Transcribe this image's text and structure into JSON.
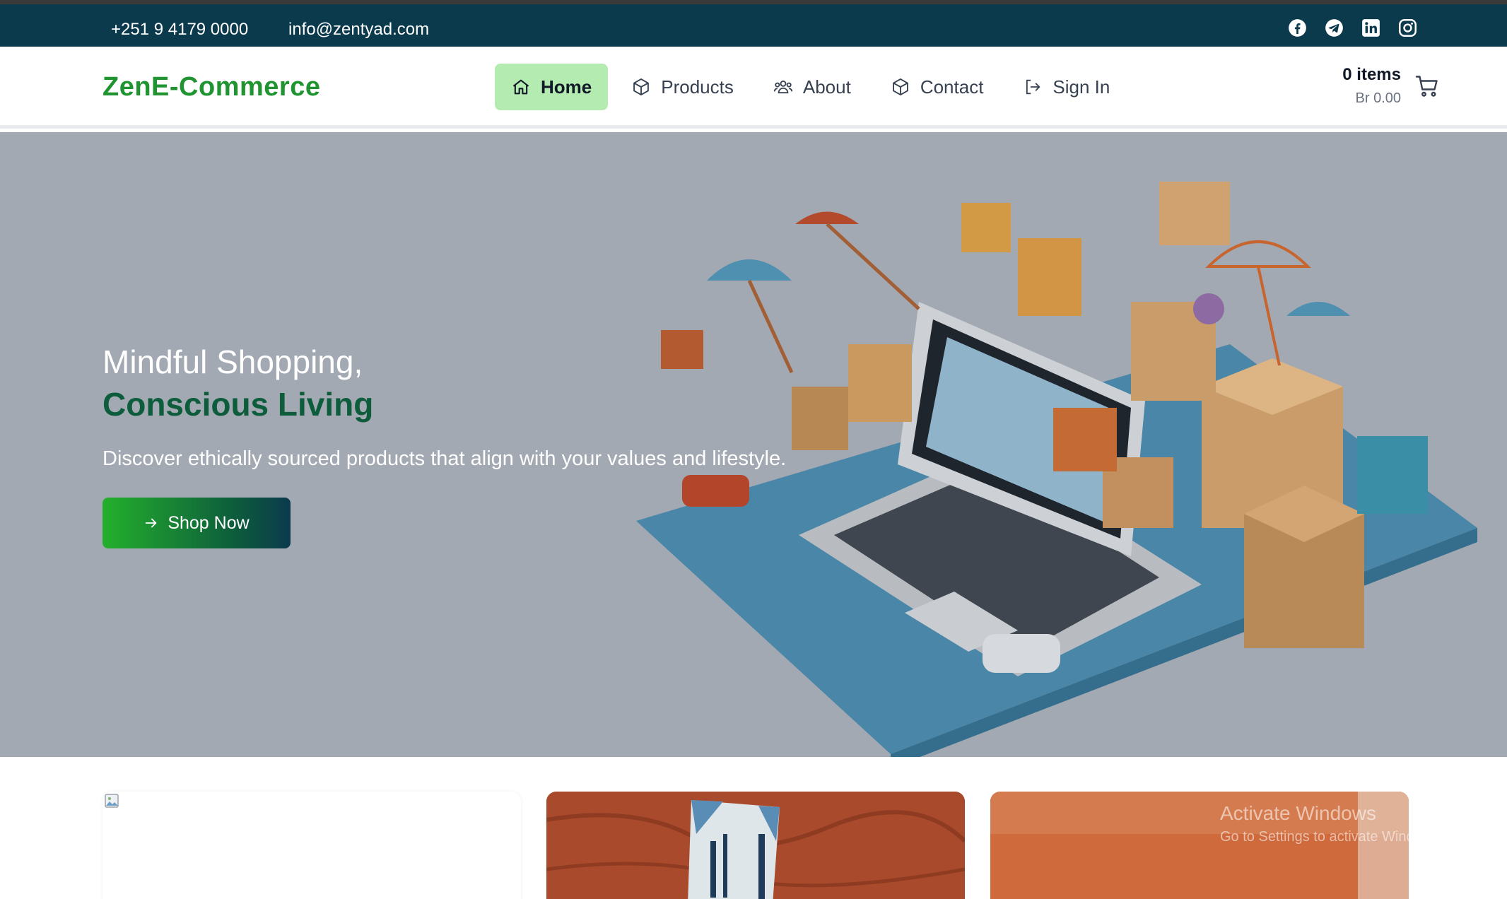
{
  "topbar": {
    "phone": "+251 9 4179 0000",
    "email": "info@zentyad.com",
    "social": [
      "facebook-icon",
      "telegram-icon",
      "linkedin-icon",
      "instagram-icon"
    ]
  },
  "header": {
    "logo": "ZenE-Commerce",
    "nav": [
      {
        "label": "Home",
        "icon": "home-icon",
        "active": true
      },
      {
        "label": "Products",
        "icon": "box-icon"
      },
      {
        "label": "About",
        "icon": "users-icon"
      },
      {
        "label": "Contact",
        "icon": "box-icon"
      },
      {
        "label": "Sign In",
        "icon": "sign-in-icon"
      }
    ],
    "cart": {
      "items": "0 items",
      "total": "Br 0.00",
      "icon": "cart-icon"
    }
  },
  "hero": {
    "title_line1": "Mindful Shopping,",
    "title_line2": "Conscious Living",
    "subtitle": "Discover ethically sourced products that align with your values and lifestyle.",
    "cta": "Shop Now"
  },
  "os_overlay": {
    "line1": "Activate Windows",
    "line2": "Go to Settings to activate Windows."
  },
  "colors": {
    "topbar": "#0b3a4d",
    "brand_green": "#1f9431",
    "nav_active": "#b4ebb0",
    "hero_bg": "#a2a9b2",
    "hero_accent": "#0d5c3b"
  }
}
